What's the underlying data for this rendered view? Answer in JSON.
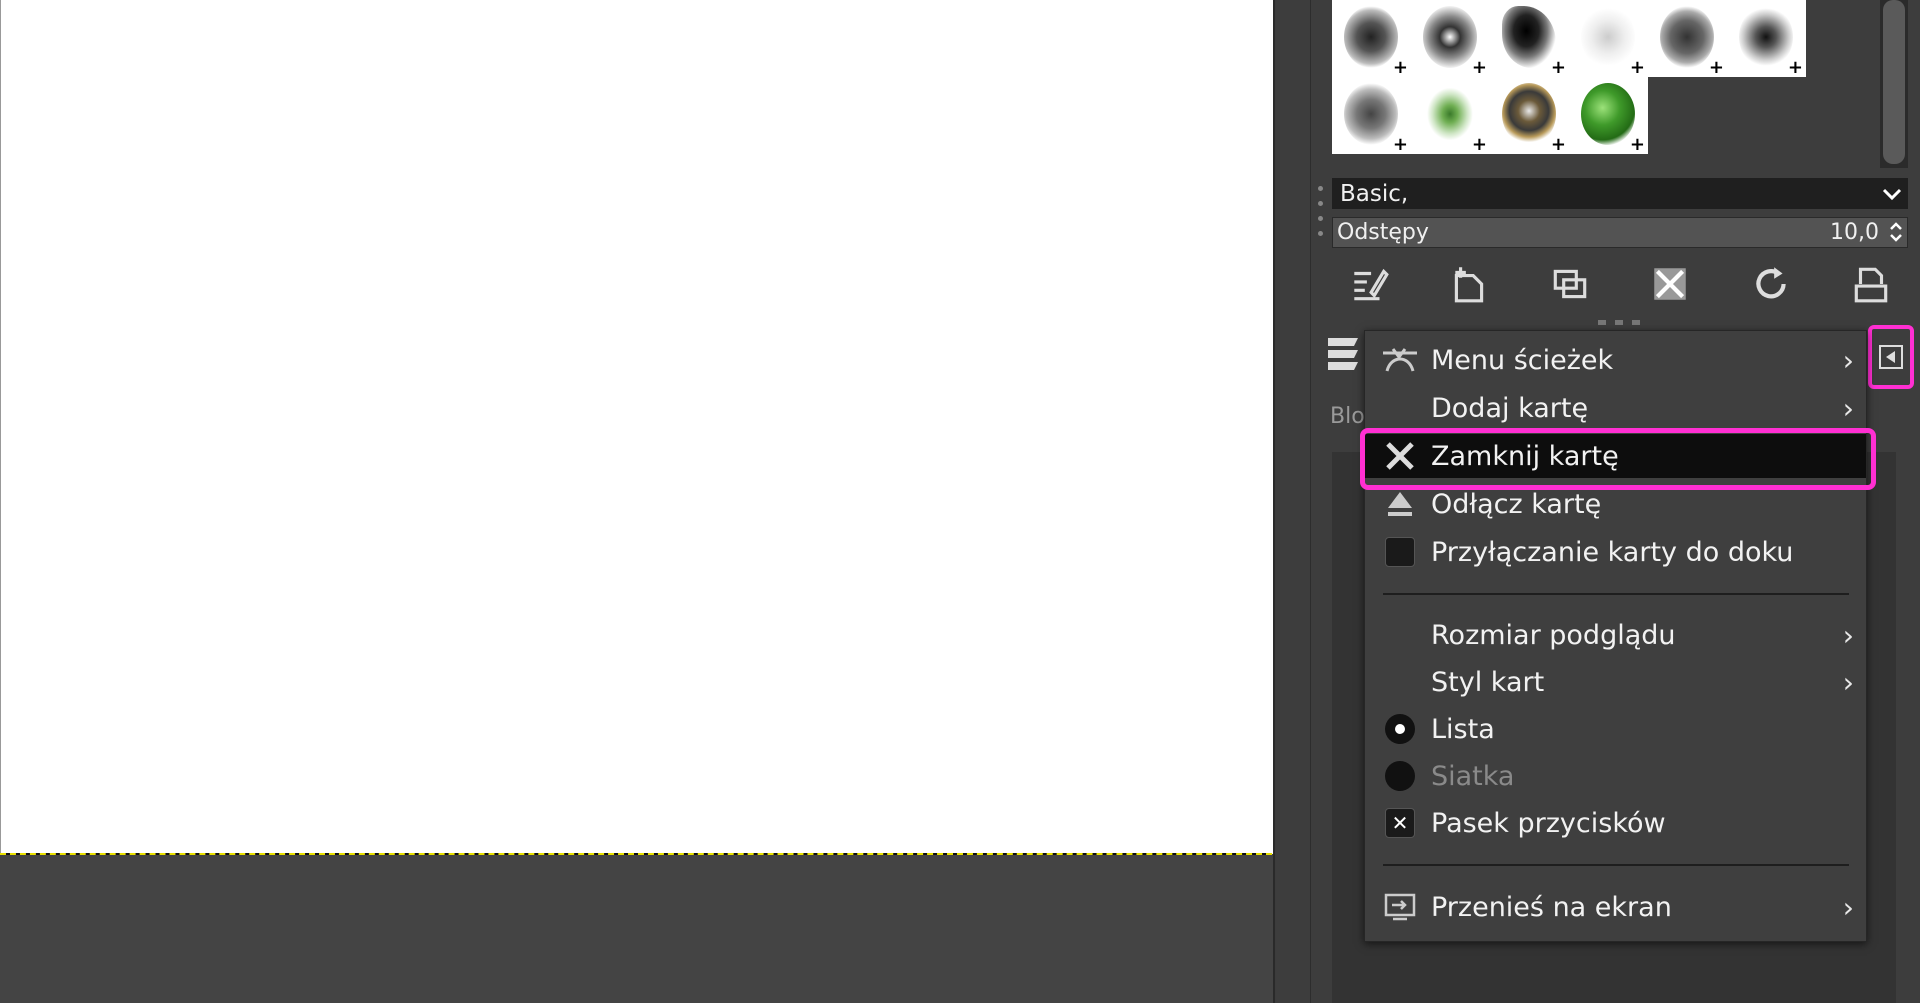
{
  "brushes": {
    "tag_filter": "Basic,",
    "spacing_label": "Odstępy",
    "spacing_value": "10,0",
    "plus_marker": "+"
  },
  "dock": {
    "partial_tab_label": "Blo"
  },
  "context_menu": {
    "items": [
      {
        "label": "Menu ścieżek",
        "icon": "paths-icon",
        "submenu": true
      },
      {
        "label": "Dodaj kartę",
        "submenu": true
      },
      {
        "label": "Zamknij kartę",
        "icon": "close-icon",
        "highlighted": true
      },
      {
        "label": "Odłącz kartę",
        "icon": "detach-icon"
      },
      {
        "label": "Przyłączanie karty do doku",
        "icon": "checkbox-unchecked"
      },
      {
        "label": "Rozmiar podglądu",
        "submenu": true
      },
      {
        "label": "Styl kart",
        "submenu": true
      },
      {
        "label": "Lista",
        "icon": "radio-selected"
      },
      {
        "label": "Siatka",
        "icon": "radio-unselected",
        "disabled": true
      },
      {
        "label": "Pasek przycisków",
        "icon": "checkbox-checked"
      },
      {
        "label": "Przenieś na ekran",
        "icon": "screen-move-icon",
        "submenu": true
      }
    ],
    "submenu_glyph": "›",
    "check_glyph": "✕"
  },
  "colors": {
    "highlight": "#ff2fd2",
    "canvas_border": "#e8e000",
    "menu_bg": "#3f3f3f",
    "active_item_bg": "#0d0d0d"
  }
}
